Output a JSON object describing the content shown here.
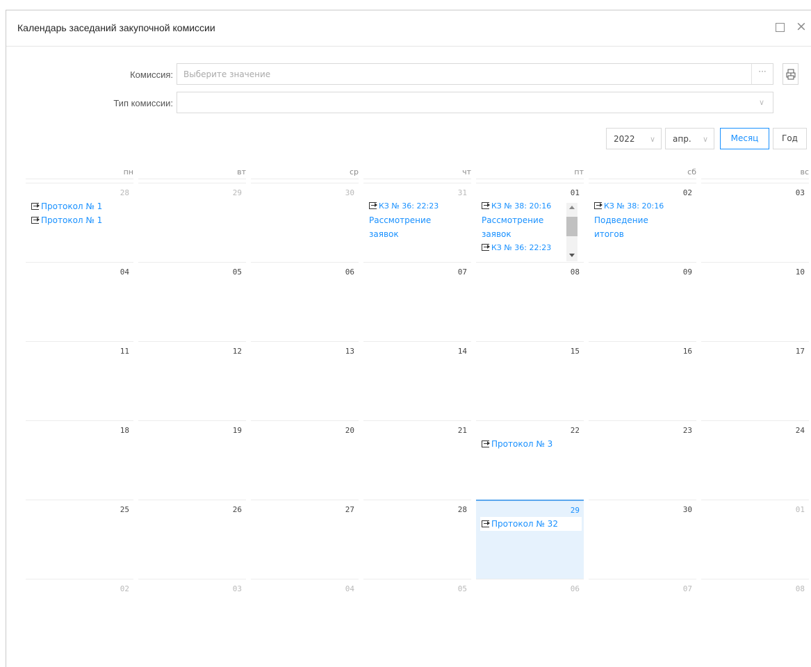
{
  "window": {
    "title": "Календарь заседаний закупочной комиссии"
  },
  "filters": {
    "commission_label": "Комиссия:",
    "commission_placeholder": "Выберите значение",
    "commission_ellipsis": "···",
    "type_label": "Тип комиссии:",
    "type_value": ""
  },
  "toolbar": {
    "year": "2022",
    "month": "апр.",
    "view_month": "Месяц",
    "view_year": "Год",
    "active_view": "Месяц"
  },
  "calendar": {
    "weekdays": [
      "пн",
      "вт",
      "ср",
      "чт",
      "пт",
      "сб",
      "вс"
    ],
    "weeks": [
      [
        {
          "d": "28",
          "other": true,
          "events": [
            "Протокол № 1",
            "Протокол № 1"
          ]
        },
        {
          "d": "29",
          "other": true,
          "events": []
        },
        {
          "d": "30",
          "other": true,
          "events": []
        },
        {
          "d": "31",
          "other": true,
          "events": [
            "КЗ № 36: 22:23",
            "Рассмотрение заявок"
          ]
        },
        {
          "d": "01",
          "other": false,
          "events": [
            "КЗ № 38: 20:16",
            "Рассмотрение заявок",
            "КЗ № 36: 22:23"
          ]
        },
        {
          "d": "02",
          "other": false,
          "events": [
            "КЗ № 38: 20:16",
            "Подведение итогов"
          ]
        },
        {
          "d": "03",
          "other": false,
          "events": []
        }
      ],
      [
        {
          "d": "04"
        },
        {
          "d": "05"
        },
        {
          "d": "06"
        },
        {
          "d": "07"
        },
        {
          "d": "08"
        },
        {
          "d": "09"
        },
        {
          "d": "10"
        }
      ],
      [
        {
          "d": "11"
        },
        {
          "d": "12"
        },
        {
          "d": "13"
        },
        {
          "d": "14"
        },
        {
          "d": "15"
        },
        {
          "d": "16"
        },
        {
          "d": "17"
        }
      ],
      [
        {
          "d": "18"
        },
        {
          "d": "19"
        },
        {
          "d": "20"
        },
        {
          "d": "21"
        },
        {
          "d": "22",
          "events": [
            "Протокол № 3"
          ]
        },
        {
          "d": "23"
        },
        {
          "d": "24"
        }
      ],
      [
        {
          "d": "25"
        },
        {
          "d": "26"
        },
        {
          "d": "27"
        },
        {
          "d": "28"
        },
        {
          "d": "29",
          "today": true,
          "events": [
            "Протокол № 32"
          ]
        },
        {
          "d": "30"
        },
        {
          "d": "01",
          "other": true
        }
      ],
      [
        {
          "d": "02",
          "other": true
        },
        {
          "d": "03",
          "other": true
        },
        {
          "d": "04",
          "other": true
        },
        {
          "d": "05",
          "other": true
        },
        {
          "d": "06",
          "other": true
        },
        {
          "d": "07",
          "other": true
        },
        {
          "d": "08",
          "other": true
        }
      ]
    ]
  },
  "colors": {
    "accent": "#1890ff",
    "today_bg": "#e6f2fd"
  }
}
